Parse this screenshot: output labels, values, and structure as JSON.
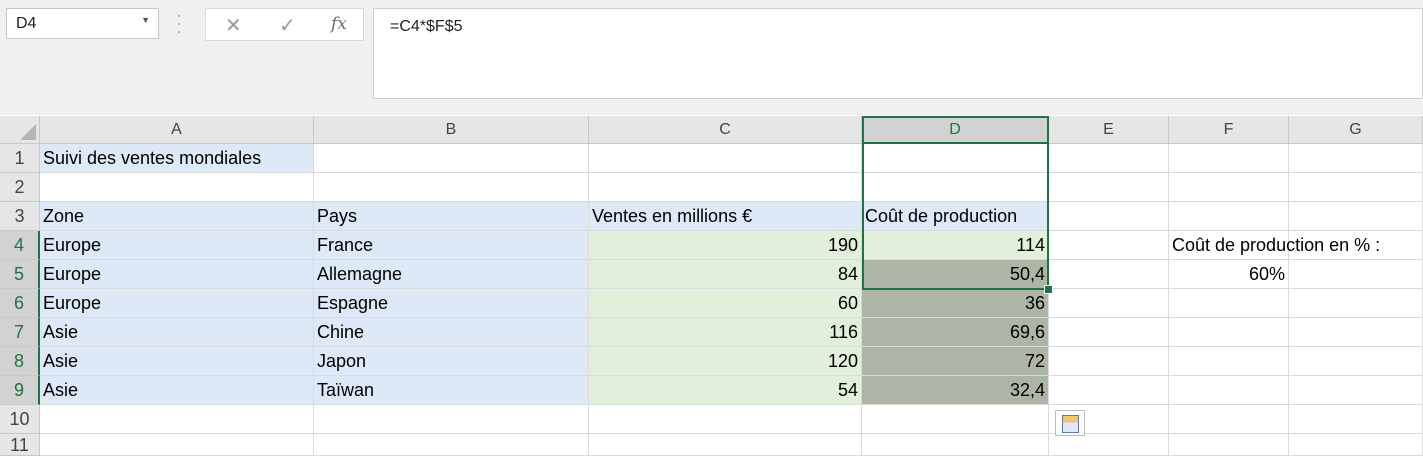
{
  "name_box": {
    "value": "D4"
  },
  "formula_bar": {
    "cancel_glyph": "✕",
    "enter_glyph": "✓",
    "fx_label": "fx",
    "formula": "=C4*$F$5"
  },
  "columns": [
    "A",
    "B",
    "C",
    "D",
    "E",
    "F",
    "G"
  ],
  "rows": [
    "1",
    "2",
    "3",
    "4",
    "5",
    "6",
    "7",
    "8",
    "9",
    "10",
    "11"
  ],
  "cells": {
    "A1": "Suivi des ventes mondiales",
    "A3": "Zone",
    "B3": "Pays",
    "C3": "Ventes en millions €",
    "D3": "Coût de production",
    "A4": "Europe",
    "B4": "France",
    "C4": "190",
    "D4": "114",
    "A5": "Europe",
    "B5": "Allemagne",
    "C5": "84",
    "D5": "50,4",
    "A6": "Europe",
    "B6": "Espagne",
    "C6": "60",
    "D6": "36",
    "A7": "Asie",
    "B7": "Chine",
    "C7": "116",
    "D7": "69,6",
    "A8": "Asie",
    "B8": "Japon",
    "C8": "120",
    "D8": "72",
    "A9": "Asie",
    "B9": "Taïwan",
    "C9": "54",
    "D9": "32,4",
    "F4": "Coût de production en % :",
    "F5": "60%"
  },
  "selection": {
    "active_cell": "D4",
    "range": "D4:D9"
  },
  "colors": {
    "accent": "#217346",
    "blue_fill": "#dde9f6",
    "green_fill": "#e2efda",
    "grey_fill": "#adb5a6"
  }
}
